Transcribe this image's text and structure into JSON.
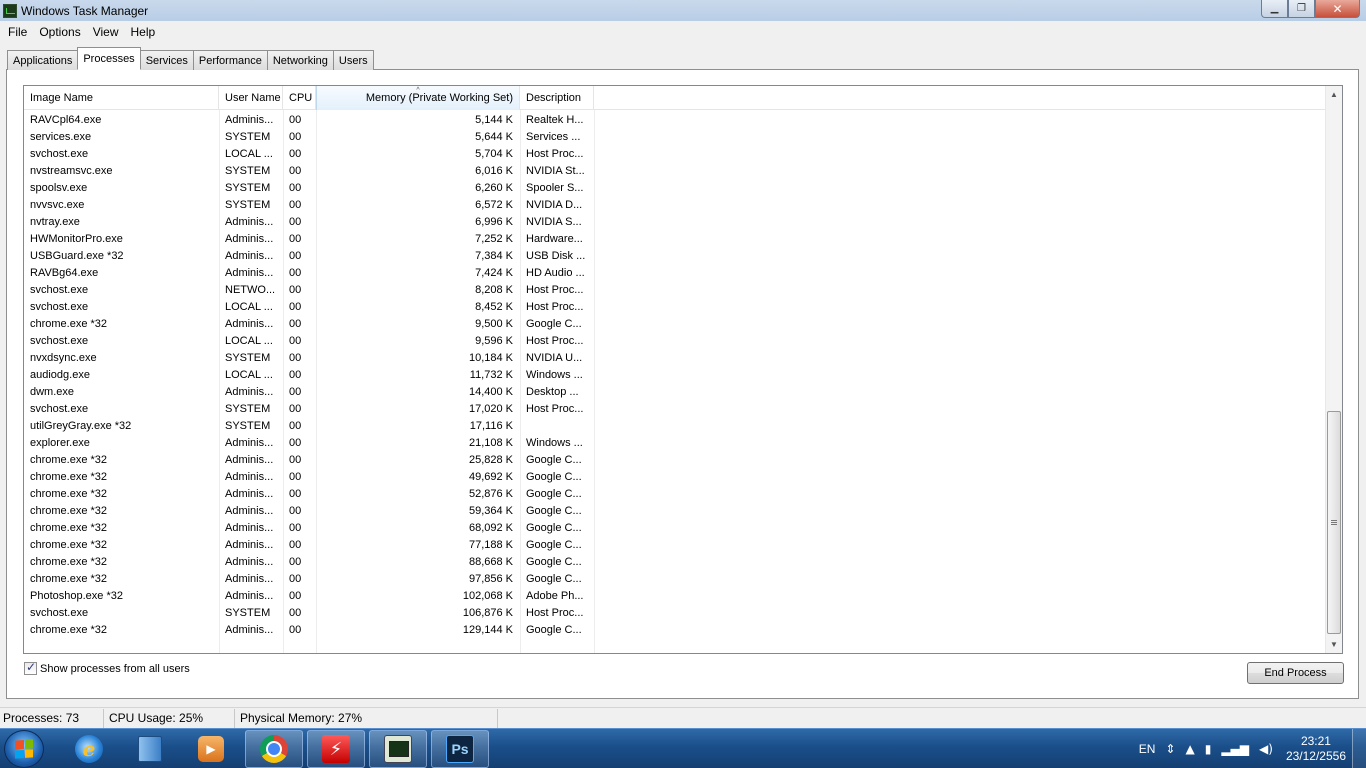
{
  "window": {
    "title": "Windows Task Manager",
    "minimize_glyph": "▁",
    "restore_glyph": "❐",
    "close_glyph": "✕"
  },
  "menu": [
    "File",
    "Options",
    "View",
    "Help"
  ],
  "tabs": [
    "Applications",
    "Processes",
    "Services",
    "Performance",
    "Networking",
    "Users"
  ],
  "active_tab": "Processes",
  "columns": {
    "image_name": "Image Name",
    "user_name": "User Name",
    "cpu": "CPU",
    "memory": "Memory (Private Working Set)",
    "description": "Description",
    "sort_indicator": "^"
  },
  "processes": [
    {
      "image": "RAVCpl64.exe",
      "user": "Adminis...",
      "cpu": "00",
      "mem": "5,144 K",
      "desc": "Realtek H..."
    },
    {
      "image": "services.exe",
      "user": "SYSTEM",
      "cpu": "00",
      "mem": "5,644 K",
      "desc": "Services ..."
    },
    {
      "image": "svchost.exe",
      "user": "LOCAL ...",
      "cpu": "00",
      "mem": "5,704 K",
      "desc": "Host Proc..."
    },
    {
      "image": "nvstreamsvc.exe",
      "user": "SYSTEM",
      "cpu": "00",
      "mem": "6,016 K",
      "desc": "NVIDIA St..."
    },
    {
      "image": "spoolsv.exe",
      "user": "SYSTEM",
      "cpu": "00",
      "mem": "6,260 K",
      "desc": "Spooler S..."
    },
    {
      "image": "nvvsvc.exe",
      "user": "SYSTEM",
      "cpu": "00",
      "mem": "6,572 K",
      "desc": "NVIDIA D..."
    },
    {
      "image": "nvtray.exe",
      "user": "Adminis...",
      "cpu": "00",
      "mem": "6,996 K",
      "desc": "NVIDIA S..."
    },
    {
      "image": "HWMonitorPro.exe",
      "user": "Adminis...",
      "cpu": "00",
      "mem": "7,252 K",
      "desc": "Hardware..."
    },
    {
      "image": "USBGuard.exe *32",
      "user": "Adminis...",
      "cpu": "00",
      "mem": "7,384 K",
      "desc": "USB Disk ..."
    },
    {
      "image": "RAVBg64.exe",
      "user": "Adminis...",
      "cpu": "00",
      "mem": "7,424 K",
      "desc": "HD Audio ..."
    },
    {
      "image": "svchost.exe",
      "user": "NETWO...",
      "cpu": "00",
      "mem": "8,208 K",
      "desc": "Host Proc..."
    },
    {
      "image": "svchost.exe",
      "user": "LOCAL ...",
      "cpu": "00",
      "mem": "8,452 K",
      "desc": "Host Proc..."
    },
    {
      "image": "chrome.exe *32",
      "user": "Adminis...",
      "cpu": "00",
      "mem": "9,500 K",
      "desc": "Google C..."
    },
    {
      "image": "svchost.exe",
      "user": "LOCAL ...",
      "cpu": "00",
      "mem": "9,596 K",
      "desc": "Host Proc..."
    },
    {
      "image": "nvxdsync.exe",
      "user": "SYSTEM",
      "cpu": "00",
      "mem": "10,184 K",
      "desc": "NVIDIA U..."
    },
    {
      "image": "audiodg.exe",
      "user": "LOCAL ...",
      "cpu": "00",
      "mem": "11,732 K",
      "desc": "Windows ..."
    },
    {
      "image": "dwm.exe",
      "user": "Adminis...",
      "cpu": "00",
      "mem": "14,400 K",
      "desc": "Desktop ..."
    },
    {
      "image": "svchost.exe",
      "user": "SYSTEM",
      "cpu": "00",
      "mem": "17,020 K",
      "desc": "Host Proc..."
    },
    {
      "image": "utilGreyGray.exe *32",
      "user": "SYSTEM",
      "cpu": "00",
      "mem": "17,116 K",
      "desc": ""
    },
    {
      "image": "explorer.exe",
      "user": "Adminis...",
      "cpu": "00",
      "mem": "21,108 K",
      "desc": "Windows ..."
    },
    {
      "image": "chrome.exe *32",
      "user": "Adminis...",
      "cpu": "00",
      "mem": "25,828 K",
      "desc": "Google C..."
    },
    {
      "image": "chrome.exe *32",
      "user": "Adminis...",
      "cpu": "00",
      "mem": "49,692 K",
      "desc": "Google C..."
    },
    {
      "image": "chrome.exe *32",
      "user": "Adminis...",
      "cpu": "00",
      "mem": "52,876 K",
      "desc": "Google C..."
    },
    {
      "image": "chrome.exe *32",
      "user": "Adminis...",
      "cpu": "00",
      "mem": "59,364 K",
      "desc": "Google C..."
    },
    {
      "image": "chrome.exe *32",
      "user": "Adminis...",
      "cpu": "00",
      "mem": "68,092 K",
      "desc": "Google C..."
    },
    {
      "image": "chrome.exe *32",
      "user": "Adminis...",
      "cpu": "00",
      "mem": "77,188 K",
      "desc": "Google C..."
    },
    {
      "image": "chrome.exe *32",
      "user": "Adminis...",
      "cpu": "00",
      "mem": "88,668 K",
      "desc": "Google C..."
    },
    {
      "image": "chrome.exe *32",
      "user": "Adminis...",
      "cpu": "00",
      "mem": "97,856 K",
      "desc": "Google C..."
    },
    {
      "image": "Photoshop.exe *32",
      "user": "Adminis...",
      "cpu": "00",
      "mem": "102,068 K",
      "desc": "Adobe Ph..."
    },
    {
      "image": "svchost.exe",
      "user": "SYSTEM",
      "cpu": "00",
      "mem": "106,876 K",
      "desc": "Host Proc..."
    },
    {
      "image": "chrome.exe *32",
      "user": "Adminis...",
      "cpu": "00",
      "mem": "129,144 K",
      "desc": "Google C..."
    }
  ],
  "scrollbar": {
    "up_glyph": "▲",
    "down_glyph": "▼"
  },
  "show_all_users": {
    "label": "Show processes from all users",
    "checked": true
  },
  "end_process_label": "End Process",
  "status": {
    "processes": "Processes: 73",
    "cpu": "CPU Usage: 25%",
    "memory": "Physical Memory: 27%"
  },
  "taskbar": {
    "apps": [
      "start-orb",
      "internet-explorer",
      "libraries",
      "media-player",
      "chrome",
      "flash-tool",
      "task-manager",
      "photoshop"
    ],
    "ie_glyph": "e",
    "media_glyph": "▶",
    "flash_glyph": "⚡",
    "ps_glyph": "Ps",
    "flag_colors": [
      "#f25022",
      "#7fba00",
      "#00a4ef",
      "#ffb900"
    ],
    "language": "EN",
    "time": "23:21",
    "date": "23/12/2556",
    "tray_glyphs": {
      "lang_arrow": "⇕",
      "show_hidden": "▲",
      "network": "▮",
      "signal": "▂▄▆",
      "volume": "◀)"
    }
  }
}
